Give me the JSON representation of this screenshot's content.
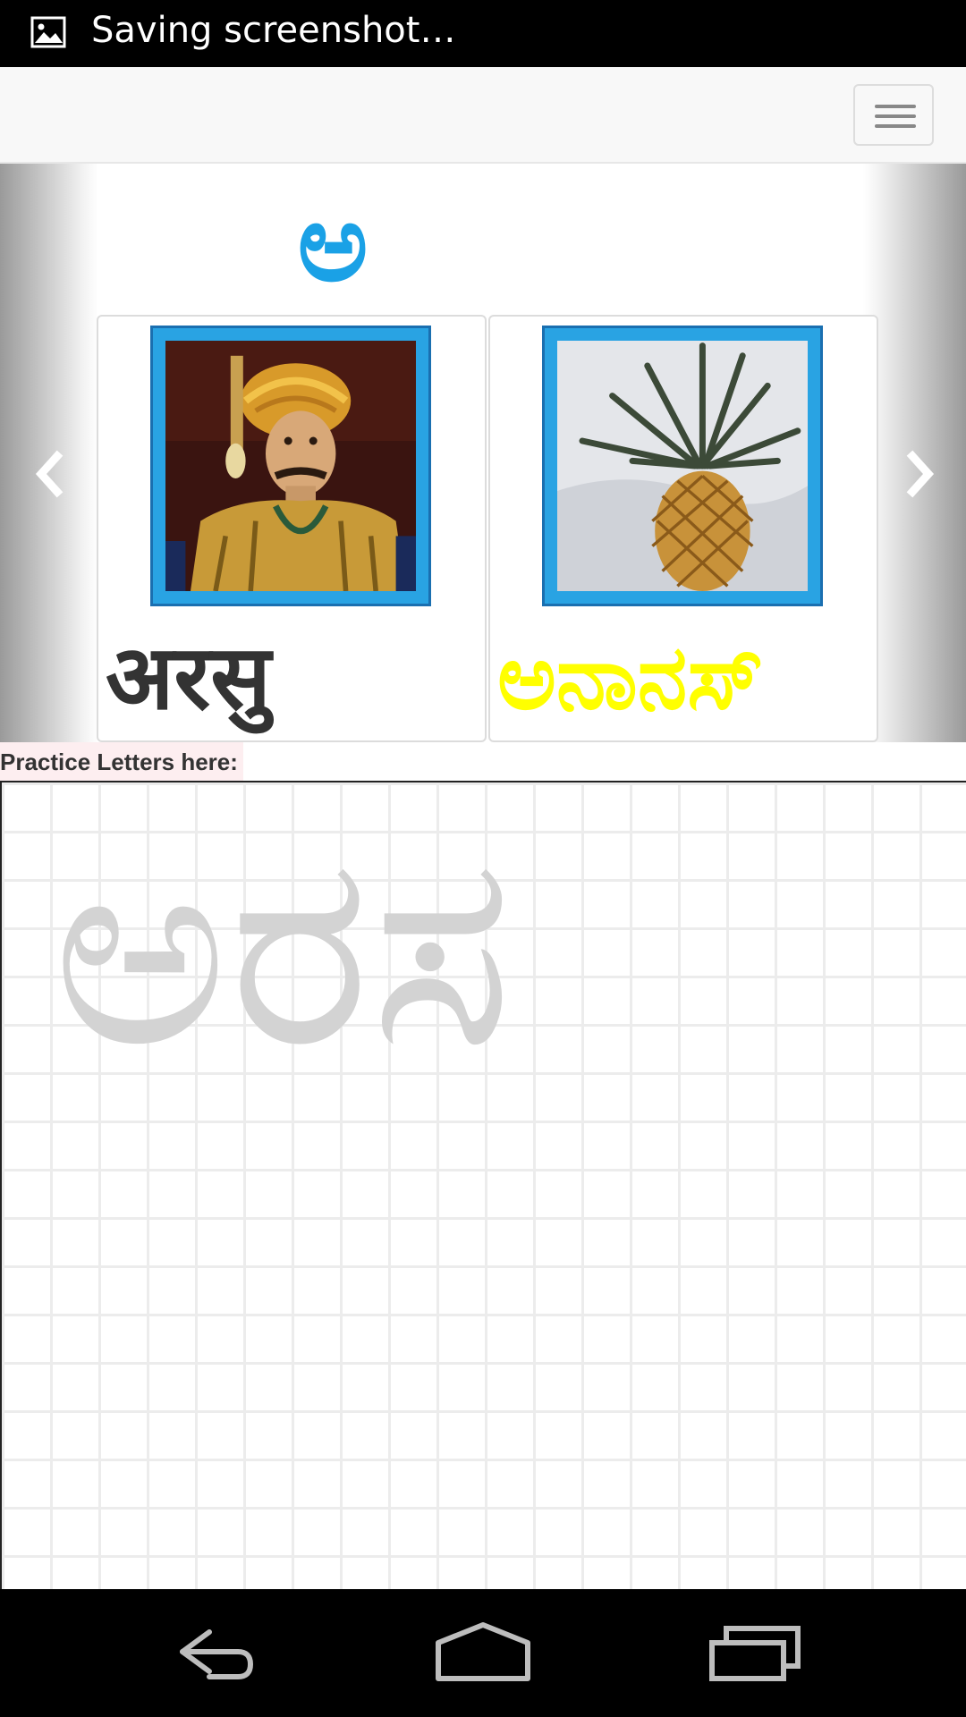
{
  "status_bar": {
    "text": "Saving screenshot…",
    "icon": "image-icon"
  },
  "navbar": {
    "menu_icon": "hamburger-menu-icon"
  },
  "carousel": {
    "letter": "ಅ",
    "prev_icon": "chevron-left-icon",
    "next_icon": "chevron-right-icon",
    "cards": [
      {
        "word": "अरसु",
        "word_color": "#333333",
        "image": "king-portrait"
      },
      {
        "word": "ಅನಾನಸ್",
        "word_color": "#ffff00",
        "image": "pineapple"
      }
    ]
  },
  "practice": {
    "label": "Practice Letters here:",
    "trace_text": "ಅರಸ"
  },
  "system_nav": {
    "back_icon": "back-icon",
    "home_icon": "home-icon",
    "recents_icon": "recents-icon"
  }
}
